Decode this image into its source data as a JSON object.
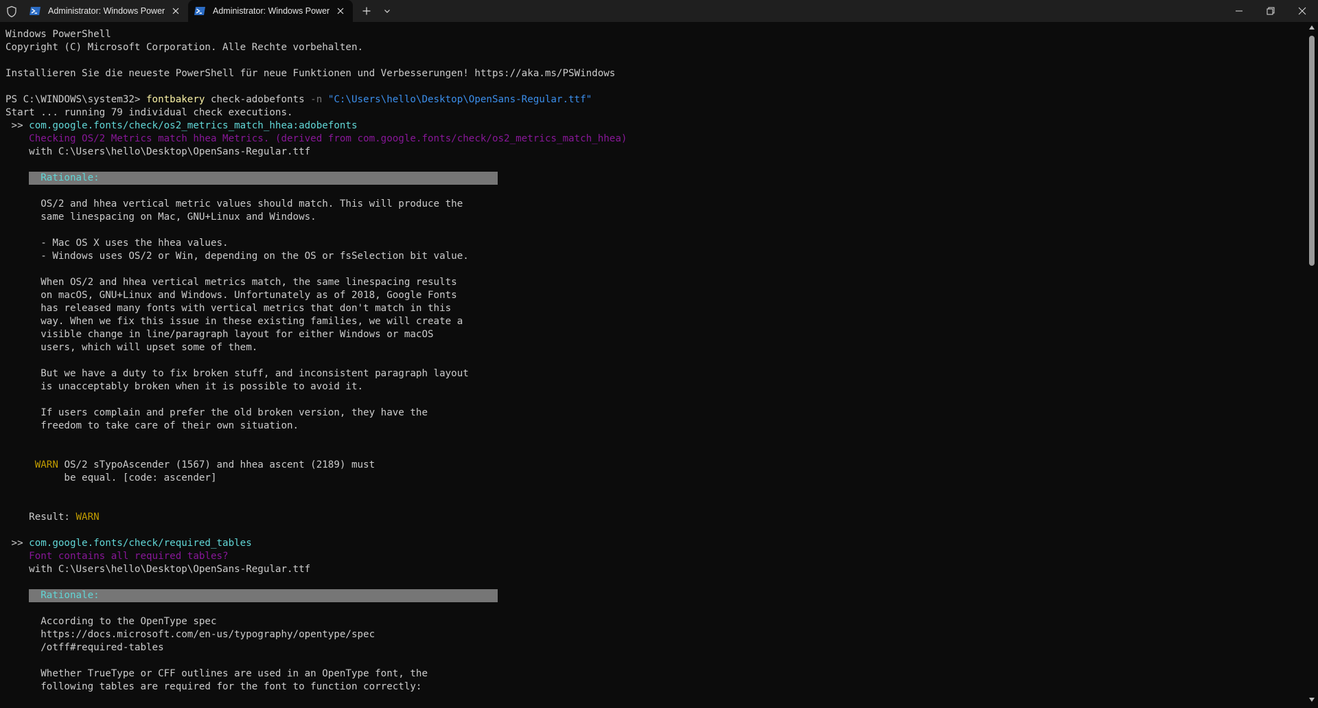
{
  "tabs": [
    {
      "title": "Administrator: Windows PowerShell"
    },
    {
      "title": "Administrator: Windows PowerShell"
    }
  ],
  "terminal": {
    "header1": "Windows PowerShell",
    "header2": "Copyright (C) Microsoft Corporation. Alle Rechte vorbehalten.",
    "header3": "Installieren Sie die neueste PowerShell für neue Funktionen und Verbesserungen! https://aka.ms/PSWindows",
    "prompt": "PS C:\\WINDOWS\\system32> ",
    "cmd_name": "fontbakery",
    "cmd_sub": " check-adobefonts ",
    "cmd_flag": "-n",
    "cmd_path": "\"C:\\Users\\hello\\Desktop\\OpenSans-Regular.ttf\"",
    "start_line": "Start ... running 79 individual check executions.",
    "check_marker": " >> ",
    "check1": {
      "id": "com.google.fonts/check/os2_metrics_match_hhea:adobefonts",
      "desc": "Checking OS/2 Metrics match hhea Metrics. (derived from com.google.fonts/check/os2_metrics_match_hhea)",
      "with": "with C:\\Users\\hello\\Desktop\\OpenSans-Regular.ttf",
      "rationale_label": "Rationale:",
      "rationale": [
        "OS/2 and hhea vertical metric values should match. This will produce the",
        "same linespacing on Mac, GNU+Linux and Windows.",
        "",
        "- Mac OS X uses the hhea values.",
        "- Windows uses OS/2 or Win, depending on the OS or fsSelection bit value.",
        "",
        "When OS/2 and hhea vertical metrics match, the same linespacing results",
        "on macOS, GNU+Linux and Windows. Unfortunately as of 2018, Google Fonts",
        "has released many fonts with vertical metrics that don't match in this",
        "way. When we fix this issue in these existing families, we will create a",
        "visible change in line/paragraph layout for either Windows or macOS",
        "users, which will upset some of them.",
        "",
        "But we have a duty to fix broken stuff, and inconsistent paragraph layout",
        "is unacceptably broken when it is possible to avoid it.",
        "",
        "If users complain and prefer the old broken version, they have the",
        "freedom to take care of their own situation."
      ],
      "warn_label": "WARN",
      "warn_line1": "OS/2 sTypoAscender (1567) and hhea ascent (2189) must",
      "warn_line2": "be equal. [code: ascender]",
      "result_label": "Result: ",
      "result_value": "WARN"
    },
    "check2": {
      "id": "com.google.fonts/check/required_tables",
      "desc": "Font contains all required tables?",
      "with": "with C:\\Users\\hello\\Desktop\\OpenSans-Regular.ttf",
      "rationale_label": "Rationale:",
      "rationale": [
        "According to the OpenType spec",
        "https://docs.microsoft.com/en-us/typography/opentype/spec",
        "/otff#required-tables",
        "",
        "Whether TrueType or CFF outlines are used in an OpenType font, the",
        "following tables are required for the font to function correctly:"
      ]
    }
  },
  "colors": {
    "background": "#0c0c0c",
    "titlebar": "#1f1f1f",
    "text": "#cccccc",
    "command": "#f9f1a5",
    "flag": "#767676",
    "path": "#3b8eea",
    "check_id": "#61d6d6",
    "check_desc": "#881798",
    "warn": "#c19c00",
    "rationale_bar": "#767676"
  }
}
